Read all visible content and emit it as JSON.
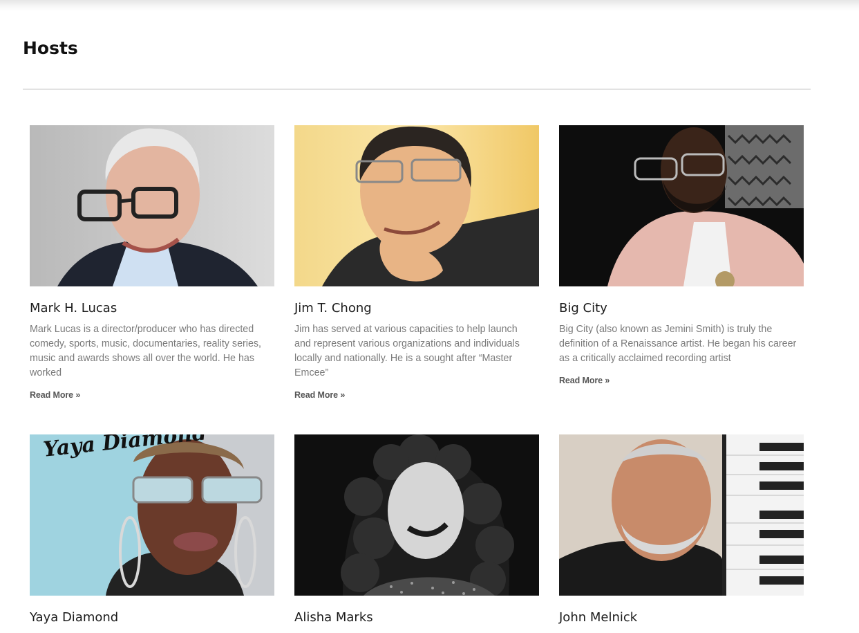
{
  "page": {
    "title": "Hosts"
  },
  "hosts": [
    {
      "name": "Mark H. Lucas",
      "excerpt": "Mark Lucas is a director/producer who has directed comedy, sports, music, documentaries, reality series, music and awards shows all over the world. He has worked",
      "read_more": "Read More »",
      "photo_icon": "portrait-photo"
    },
    {
      "name": "Jim T. Chong",
      "excerpt": "Jim has served at various capacities to help launch and represent various organizations and individuals locally and nationally.  He is a sought after “Master Emcee”",
      "read_more": "Read More »",
      "photo_icon": "portrait-photo"
    },
    {
      "name": "Big City",
      "excerpt": "Big City (also known as Jemini Smith) is truly the definition of a Renaissance artist. He began his career as a critically acclaimed recording artist",
      "read_more": "Read More »",
      "photo_icon": "portrait-photo"
    },
    {
      "name": "Yaya Diamond",
      "photo_caption": "Yaya Diamond",
      "photo_icon": "portrait-photo"
    },
    {
      "name": "Alisha Marks",
      "photo_icon": "portrait-photo"
    },
    {
      "name": "John Melnick",
      "photo_icon": "portrait-photo"
    }
  ],
  "colors": {
    "title": "#111111",
    "name": "#1b1b1b",
    "excerpt": "#7a7a7a",
    "read_more": "#555555",
    "divider": "#e2e2e2"
  }
}
